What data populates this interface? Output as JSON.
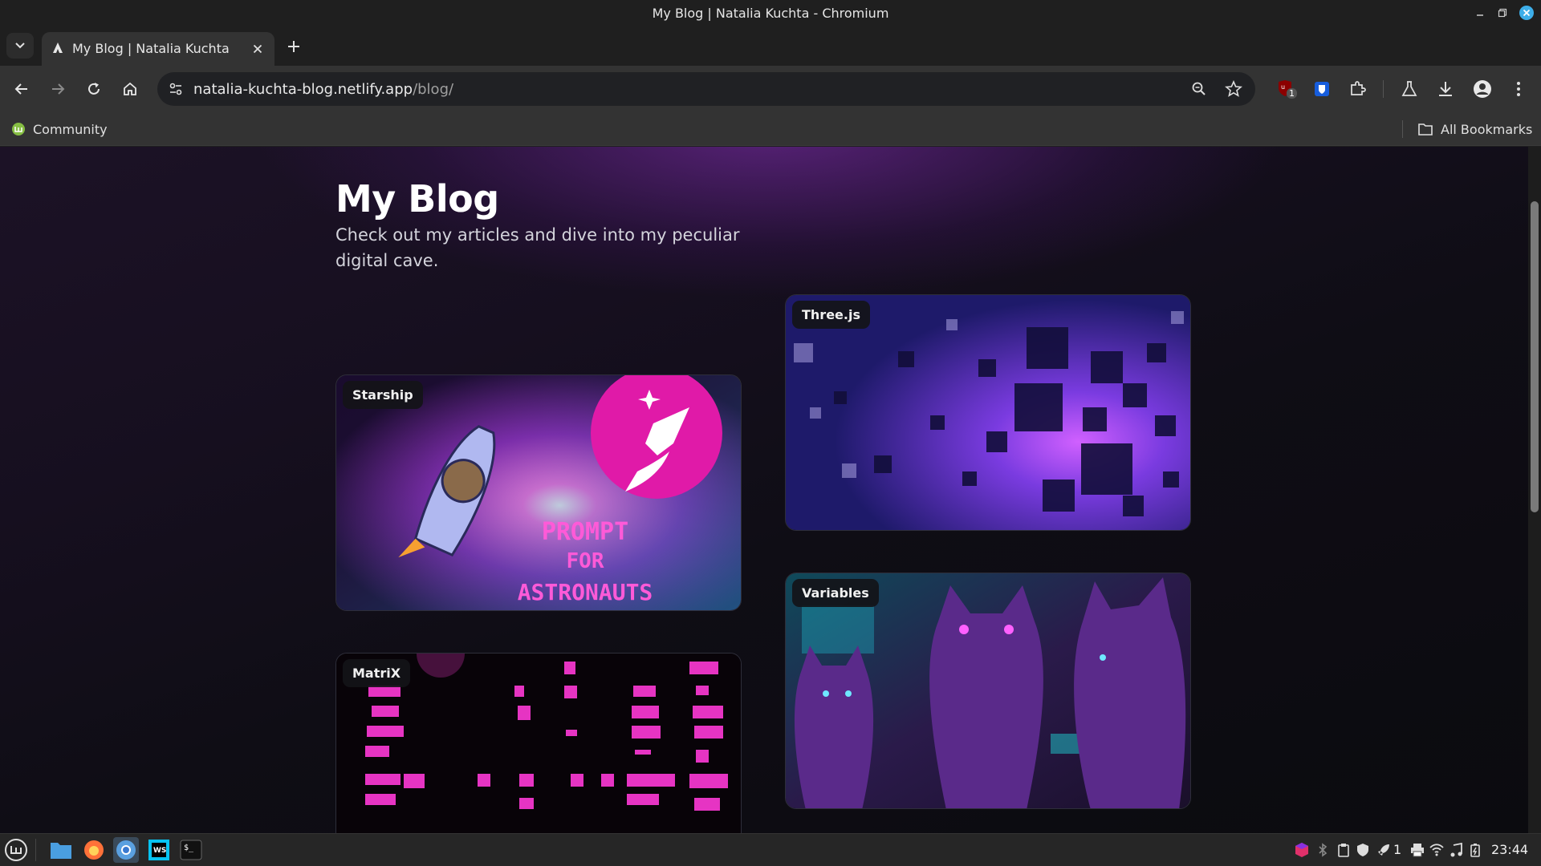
{
  "window": {
    "title": "My Blog | Natalia Kuchta - Chromium"
  },
  "tab": {
    "title": "My Blog | Natalia Kuchta"
  },
  "address": {
    "host": "natalia-kuchta-blog.netlify.app",
    "path": "/blog/"
  },
  "extensions": {
    "ublock_badge": "1"
  },
  "bookmarks": {
    "community": "Community",
    "all": "All Bookmarks"
  },
  "page": {
    "title": "My Blog",
    "subtitle": "Check out my articles and dive into my peculiar digital cave.",
    "cards": [
      {
        "tag": "Three.js"
      },
      {
        "tag": "Starship",
        "art_text": [
          "PROMPT",
          "FOR",
          "ASTRONAUTS"
        ]
      },
      {
        "tag": "Variables"
      },
      {
        "tag": "MatriX"
      }
    ]
  },
  "taskbar": {
    "workspace": "1",
    "clock": "23:44"
  },
  "colors": {
    "accent_purple": "#8a2be2",
    "magenta": "#e020c0",
    "browser_bg": "#1f1f1f",
    "toolbar_bg": "#333333"
  }
}
